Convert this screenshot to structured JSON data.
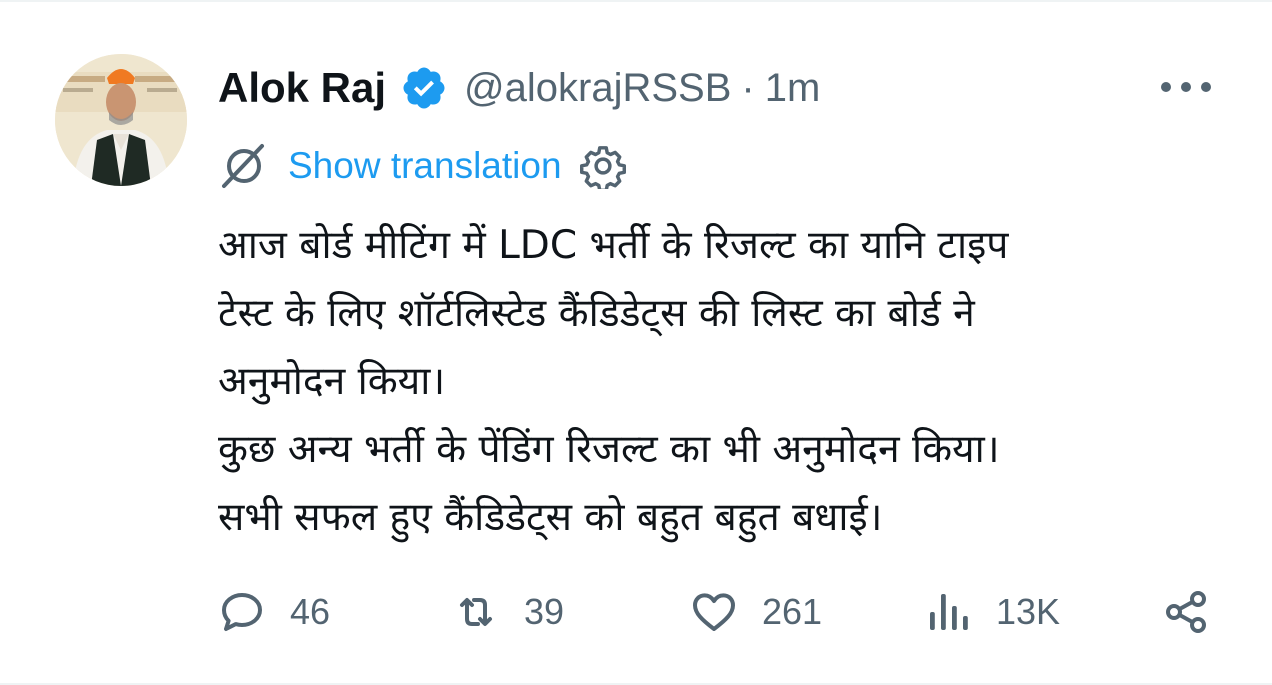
{
  "tweet": {
    "author_name": "Alok Raj",
    "handle": "@alokrajRSSB",
    "separator": "·",
    "time": "1m",
    "translate_label": "Show translation",
    "body_lines": [
      "आज बोर्ड मीटिंग में LDC भर्ती के रिजल्ट का यानि टाइप",
      "टेस्ट के लिए शॉर्टलिस्टेड कैंडिडेट्स की लिस्ट का बोर्ड ने",
      "अनुमोदन किया।",
      "कुछ अन्य भर्ती के पेंडिंग रिजल्ट का भी अनुमोदन किया।",
      "सभी सफल हुए कैंडिडेट्स को बहुत बहुत बधाई।"
    ]
  },
  "actions": {
    "replies": "46",
    "retweets": "39",
    "likes": "261",
    "views": "13K"
  },
  "icons": {
    "verified": "verified-badge-icon",
    "more": "more-dots-icon",
    "translate": "translate-globe-icon",
    "settings": "gear-icon",
    "reply": "reply-bubble-icon",
    "retweet": "retweet-icon",
    "like": "heart-icon",
    "views": "views-bars-icon",
    "share": "share-icon"
  },
  "colors": {
    "accent": "#1d9bf0",
    "text": "#0f1419",
    "muted": "#536471"
  }
}
